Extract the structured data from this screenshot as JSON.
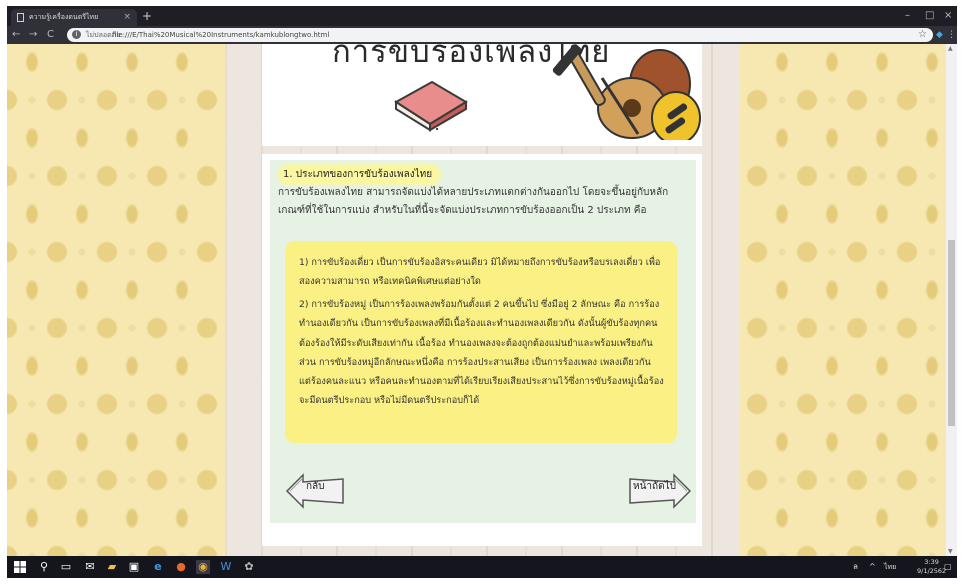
{
  "browser": {
    "tab_title": "ความรู้เครื่องดนตรีไทย",
    "tab_close": "×",
    "new_tab": "+",
    "win_min": "–",
    "win_max": "□",
    "win_close": "×",
    "nav_back": "←",
    "nav_forward": "→",
    "nav_reload": "C",
    "security_label": "ไม่ปลอดภัย",
    "url": "file:///E/Thai%20Musical%20Instruments/kamkublongtwo.html",
    "bookmark": "☆"
  },
  "banner": {
    "heading_partial": "การขับร้องเพลงไทย"
  },
  "content": {
    "heading": "1. ประเภทของการขับร้องเพลงไทย",
    "intro": "การขับร้องเพลงไทย สามารถจัดแบ่งได้หลายประเภทแตกต่างกันออกไป โดยจะขึ้นอยู่กับหลักเกณฑ์ที่ใช้ในการแบ่ง สำหรับในที่นี้จะจัดแบ่งประเภทการขับร้องออกเป็น 2 ประเภท คือ",
    "para1": "1) การขับร้องเดี่ยว เป็นการขับร้องอิสระคนเดียว มิได้หมายถึงการขับร้องหรือบรเลงเดี่ยว เพื่อ สองความสามารถ หรือเทคนิคพิเศษแต่อย่างใด",
    "para2": "2) การขับร้องหมู่ เป็นการร้องเพลงพร้อมกันตั้งแต่ 2 คนขึ้นไป ซึ่งมีอยู่ 2 ลักษณะ คือ การร้องทำนองเดียวกัน เป็นการขับร้องเพลงที่มีเนื้อร้องและทำนองเพลงเดียวกัน ดังนั้นผู้ขับร้องทุกคนต้องร้องให้มีระดับเสียงเท่ากัน เนื้อร้อง ทำนองเพลงจะต้องถูกต้องแม่นยำและพร้อมเพรียงกัน ส่วน การขับร้องหมู่อีกลักษณะหนึ่งคือ การร้องประสานเสียง เป็นการร้องเพลง เพลงเดียวกัน แต่ร้องคนละแนว หรือคนละทำนองตามที่ได้เรียบเรียงเสียงประสานไว้ซึ่งการขับร้องหมู่เนื้อร้องจะมีดนตรีประกอบ หรือไม่มีดนตรีประกอบก็ได้",
    "back_label": "กลับ",
    "next_label": "หน้าถัดไป"
  },
  "taskbar": {
    "time": "3:39",
    "date": "9/1/2562",
    "lang": "ไทย",
    "tray_up": "^",
    "network": "ล"
  },
  "colors": {
    "green_panel": "#e6f3e4",
    "yellow_box": "#fbf084",
    "damask_bg": "#f7e8b2"
  }
}
